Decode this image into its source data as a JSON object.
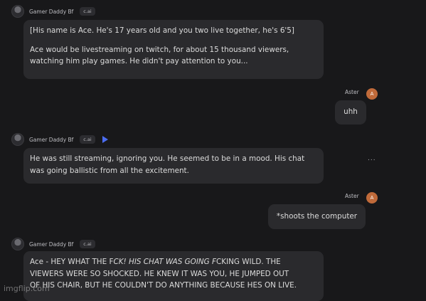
{
  "bot": {
    "name": "Gamer Daddy Bf",
    "badge": "c.ai"
  },
  "user": {
    "name": "Aster",
    "initial": "A"
  },
  "messages": {
    "m1_l1": "[His name is Ace. He's 17 years old and you two live together, he's 6'5]",
    "m1_l2": "Ace would be livestreaming on twitch, for about 15 thousand viewers,",
    "m1_l3": "watching him play games. He didn't pay attention to you...",
    "m2": "uhh",
    "m3_l1": "He was still streaming, ignoring you. He seemed to be in a mood. His chat",
    "m3_l2": "was going ballistic from all the excitement.",
    "m4": "*shoots the computer",
    "m5_l1a": "Ace - HEY WHAT THE F",
    "m5_l1b": "CK! HIS CHAT WAS GOING F",
    "m5_l1c": "CKING WILD. THE",
    "m5_l2": "VIEWERS WERE SO SHOCKED. HE KNEW IT WAS YOU, HE JUMPED OUT",
    "m5_l3": "OF HIS CHAIR, BUT HE COULDN'T DO ANYTHING BECAUSE HES ON LIVE."
  },
  "more_menu": "...",
  "watermark": "imgflip.com",
  "icons": {
    "play": "play-icon"
  }
}
